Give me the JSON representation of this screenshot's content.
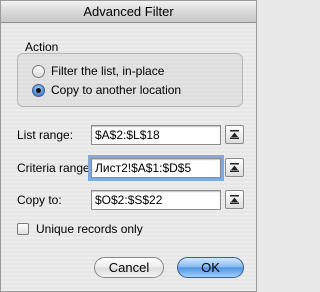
{
  "window": {
    "title": "Advanced Filter"
  },
  "action": {
    "label": "Action",
    "options": [
      {
        "label": "Filter the list, in-place",
        "selected": false
      },
      {
        "label": "Copy to another location",
        "selected": true
      }
    ]
  },
  "fields": {
    "list_range": {
      "label": "List range:",
      "value": "$A$2:$L$18"
    },
    "criteria_range": {
      "label": "Criteria range:",
      "value": "Лист2!$A$1:$D$5"
    },
    "copy_to": {
      "label": "Copy to:",
      "value": "$O$2:$S$22"
    }
  },
  "unique_records": {
    "label": "Unique records only",
    "checked": false
  },
  "buttons": {
    "cancel": "Cancel",
    "ok": "OK"
  },
  "icons": {
    "collapse": "range-collapse-icon"
  }
}
